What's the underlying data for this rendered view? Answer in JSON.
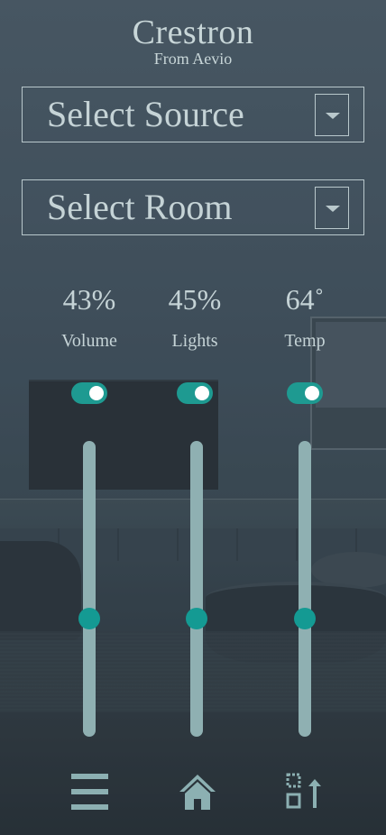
{
  "brand": {
    "title": "Crestron",
    "subtitle": "From Aevio"
  },
  "source_select": {
    "label": "Select Source",
    "button_icon": "chevron-down-icon"
  },
  "room_select": {
    "label": "Select Room",
    "button_icon": "chevron-down-icon"
  },
  "controls": [
    {
      "value": "43%",
      "label": "Volume",
      "toggle_on": true,
      "slider_level": 0.39
    },
    {
      "value": "45%",
      "label": "Lights",
      "toggle_on": true,
      "slider_level": 0.39
    },
    {
      "value": "64˚",
      "label": "Temp",
      "toggle_on": true,
      "slider_level": 0.39
    }
  ],
  "bottom_nav": [
    {
      "icon": "menu-icon"
    },
    {
      "icon": "home-icon"
    },
    {
      "icon": "export-icon"
    }
  ],
  "colors": {
    "accent": "#149a93",
    "track": "#8fb0b2",
    "text": "#c5d3d6",
    "border": "#b9c8cc"
  }
}
